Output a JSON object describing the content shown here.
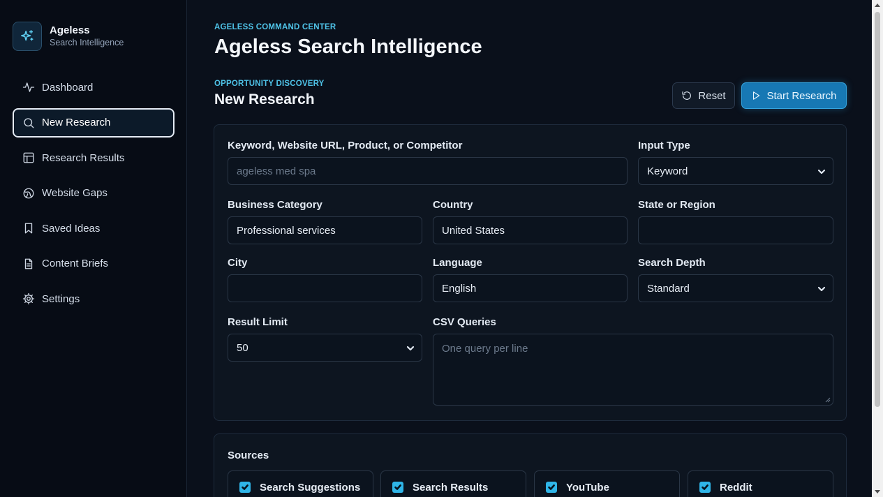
{
  "brand": {
    "name": "Ageless",
    "subtitle": "Search Intelligence",
    "icon": "sparkles-icon"
  },
  "sidebar": {
    "items": [
      {
        "label": "Dashboard",
        "icon": "activity-icon",
        "active": false
      },
      {
        "label": "New Research",
        "icon": "search-icon",
        "active": true
      },
      {
        "label": "Research Results",
        "icon": "table-icon",
        "active": false
      },
      {
        "label": "Website Gaps",
        "icon": "globe-icon",
        "active": false
      },
      {
        "label": "Saved Ideas",
        "icon": "bookmark-icon",
        "active": false
      },
      {
        "label": "Content Briefs",
        "icon": "document-icon",
        "active": false
      },
      {
        "label": "Settings",
        "icon": "gear-icon",
        "active": false
      }
    ]
  },
  "header": {
    "eyebrow": "AGELESS COMMAND CENTER",
    "title": "Ageless Search Intelligence"
  },
  "section": {
    "eyebrow": "OPPORTUNITY DISCOVERY",
    "title": "New Research"
  },
  "actions": {
    "reset": "Reset",
    "start": "Start Research"
  },
  "form": {
    "keyword": {
      "label": "Keyword, Website URL, Product, or Competitor",
      "value": "",
      "placeholder": "ageless med spa"
    },
    "input_type": {
      "label": "Input Type",
      "value": "Keyword"
    },
    "business_category": {
      "label": "Business Category",
      "value": "Professional services"
    },
    "country": {
      "label": "Country",
      "value": "United States"
    },
    "state": {
      "label": "State or Region",
      "value": ""
    },
    "city": {
      "label": "City",
      "value": ""
    },
    "language": {
      "label": "Language",
      "value": "English"
    },
    "search_depth": {
      "label": "Search Depth",
      "value": "Standard"
    },
    "result_limit": {
      "label": "Result Limit",
      "value": "50"
    },
    "csv_queries": {
      "label": "CSV Queries",
      "value": "",
      "placeholder": "One query per line"
    }
  },
  "sources": {
    "title": "Sources",
    "items": [
      {
        "label": "Search Suggestions",
        "checked": true
      },
      {
        "label": "Search Results",
        "checked": true
      },
      {
        "label": "YouTube",
        "checked": true
      },
      {
        "label": "Reddit",
        "checked": true
      }
    ]
  },
  "colors": {
    "accent": "#2fb5e8",
    "primary_button": "#1778b4",
    "background": "#0a101b"
  }
}
